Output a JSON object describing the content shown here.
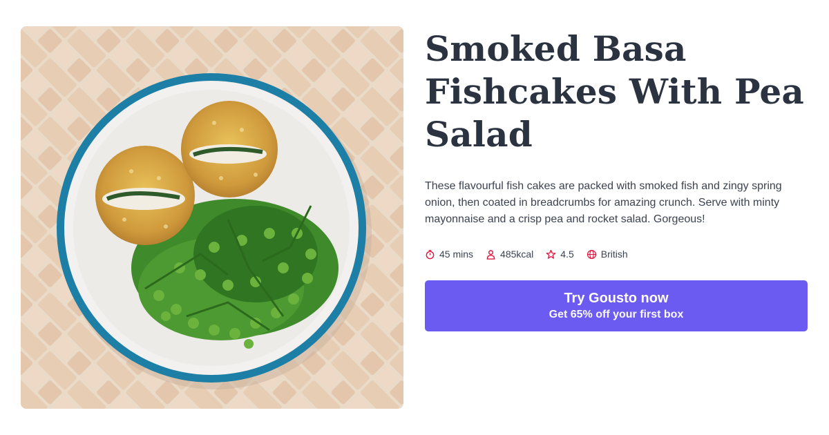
{
  "recipe": {
    "title": "Smoked Basa Fishcakes With Pea Salad",
    "description": "These flavourful fish cakes are packed with smoked fish and zingy spring onion, then coated in breadcrumbs for amazing crunch. Serve with minty mayonnaise and a crisp pea and rocket salad. Gorgeous!",
    "meta": {
      "time": {
        "icon": "stopwatch-icon",
        "label": "45 mins"
      },
      "calories": {
        "icon": "person-icon",
        "label": "485kcal"
      },
      "rating": {
        "icon": "star-icon",
        "label": "4.5"
      },
      "cuisine": {
        "icon": "globe-icon",
        "label": "British"
      }
    }
  },
  "cta": {
    "title": "Try Gousto now",
    "subtitle": "Get 65% off your first box"
  },
  "colors": {
    "accent": "#6b5bf0",
    "icon": "#e0163e",
    "text": "#2b3340",
    "plate_rim": "#1d7fa5"
  }
}
